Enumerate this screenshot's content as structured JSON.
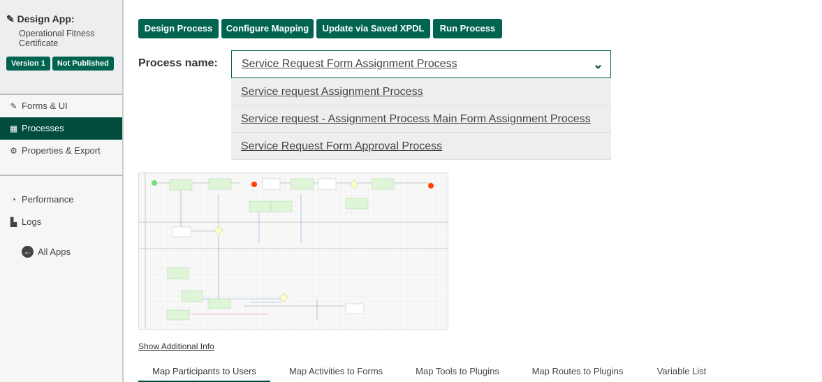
{
  "sidebar": {
    "app_label": "Design App:",
    "app_name": "Operational Fitness Certificate",
    "version": "Version 1",
    "status": "Not Published",
    "items": [
      {
        "label": "Forms & UI"
      },
      {
        "label": "Processes"
      },
      {
        "label": "Properties & Export"
      }
    ],
    "tools": [
      {
        "label": "Performance"
      },
      {
        "label": "Logs"
      }
    ],
    "all_apps": "All Apps"
  },
  "toolbar": {
    "design": "Design Process",
    "mapping": "Configure Mapping",
    "xpdl": "Update via Saved XPDL",
    "run": "Run Process"
  },
  "process": {
    "label": "Process name:",
    "selected": "Service Request Form Assignment Process",
    "options": [
      "Service request Assignment Process",
      "Service request - Assignment Process Main Form Assignment Process",
      "Service Request Form Approval Process"
    ]
  },
  "more_info": "Show Additional Info",
  "tabs": [
    "Map Participants to Users",
    "Map Activities to Forms",
    "Map Tools to Plugins",
    "Map Routes to Plugins",
    "Variable List"
  ],
  "colors": {
    "primary": "#006450",
    "active": "#004d3e"
  }
}
